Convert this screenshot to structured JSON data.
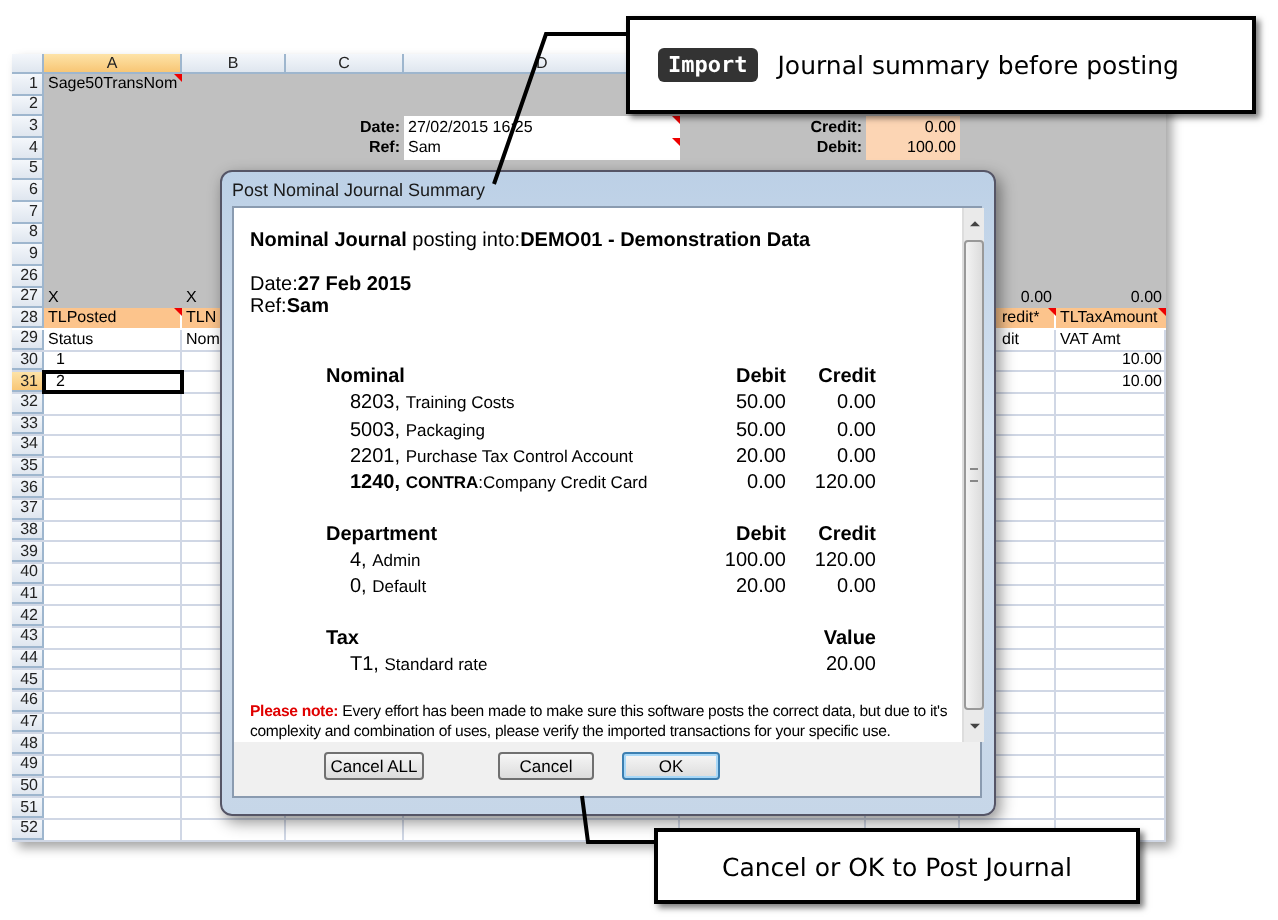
{
  "sheet": {
    "columns": [
      {
        "label": "A",
        "selected": true
      },
      {
        "label": "B",
        "selected": false
      },
      {
        "label": "C",
        "selected": false
      },
      {
        "label": "D",
        "selected": false
      }
    ],
    "rows": [
      {
        "number": "1",
        "selected": false,
        "kind": "form",
        "cells": {
          "A": {
            "text": "Sage50TransNom",
            "kind": "text",
            "comment": true,
            "selected": false
          }
        }
      },
      {
        "number": "2",
        "selected": false,
        "kind": "form"
      },
      {
        "number": "3",
        "selected": false,
        "kind": "form",
        "cells": {
          "C": {
            "text": "Date:",
            "kind": "label",
            "comment": false,
            "selected": false
          },
          "D": {
            "text": "27/02/2015 16:25",
            "kind": "input",
            "comment": true,
            "selected": false
          },
          "E": {
            "text": "Credit:",
            "kind": "label",
            "comment": false,
            "selected": false
          },
          "F": {
            "text": "0.00",
            "kind": "amount",
            "comment": false,
            "selected": false
          }
        }
      },
      {
        "number": "4",
        "selected": false,
        "kind": "form",
        "cells": {
          "C": {
            "text": "Ref:",
            "kind": "label",
            "comment": false,
            "selected": false
          },
          "D": {
            "text": "Sam",
            "kind": "input",
            "comment": true,
            "selected": false
          },
          "E": {
            "text": "Debit:",
            "kind": "label",
            "comment": false,
            "selected": false
          },
          "F": {
            "text": "100.00",
            "kind": "amount",
            "comment": false,
            "selected": false
          }
        }
      },
      {
        "number": "5",
        "selected": false,
        "kind": "form"
      },
      {
        "number": "6",
        "selected": false,
        "kind": "form"
      },
      {
        "number": "7",
        "selected": false,
        "kind": "form"
      },
      {
        "number": "8",
        "selected": false,
        "kind": "form"
      },
      {
        "number": "9",
        "selected": false,
        "kind": "form"
      },
      {
        "number": "26",
        "selected": false,
        "kind": "form"
      },
      {
        "number": "27",
        "selected": false,
        "kind": "form",
        "cells": {
          "A": {
            "text": "X",
            "kind": "text",
            "comment": false,
            "selected": false
          },
          "B": {
            "text": "X",
            "selected": false
          },
          "G": {
            "text": "0.00",
            "kind": "number",
            "comment": false,
            "selected": false
          },
          "H": {
            "text": "0.00",
            "kind": "number",
            "comment": false,
            "selected": false
          }
        }
      },
      {
        "number": "28",
        "selected": false,
        "kind": "header",
        "cells": {
          "A": {
            "text": "TLPosted",
            "kind": "text",
            "comment": true,
            "selected": false
          },
          "B": {
            "text": "TLN",
            "selected": false
          },
          "G": {
            "text": "redit*",
            "kind": "clipped",
            "comment": true,
            "selected": false
          },
          "H": {
            "text": "TLTaxAmount",
            "kind": "text",
            "comment": true,
            "selected": false
          }
        }
      },
      {
        "number": "29",
        "selected": false,
        "kind": "data",
        "cells": {
          "A": {
            "text": "Status",
            "kind": "text",
            "comment": false,
            "selected": false
          },
          "B": {
            "text": "Nom",
            "selected": false
          },
          "G": {
            "text": "dit",
            "kind": "clipped",
            "comment": false,
            "selected": false
          },
          "H": {
            "text": "VAT Amt",
            "kind": "text",
            "comment": false,
            "selected": false
          }
        }
      },
      {
        "number": "30",
        "selected": false,
        "kind": "data",
        "cells": {
          "A": {
            "text": "1",
            "kind": "indent",
            "comment": false,
            "selected": false
          },
          "H": {
            "text": "10.00",
            "kind": "number",
            "comment": false,
            "selected": false
          }
        }
      },
      {
        "number": "31",
        "selected": true,
        "kind": "data",
        "cells": {
          "A": {
            "text": "2",
            "kind": "indent",
            "comment": false,
            "selected": true
          },
          "H": {
            "text": "10.00",
            "kind": "number",
            "comment": false,
            "selected": false
          }
        }
      },
      {
        "number": "32",
        "selected": false,
        "kind": "data"
      },
      {
        "number": "33",
        "selected": false,
        "kind": "data"
      },
      {
        "number": "34",
        "selected": false,
        "kind": "data"
      },
      {
        "number": "35",
        "selected": false,
        "kind": "data"
      },
      {
        "number": "36",
        "selected": false,
        "kind": "data"
      },
      {
        "number": "37",
        "selected": false,
        "kind": "data"
      },
      {
        "number": "38",
        "selected": false,
        "kind": "data"
      },
      {
        "number": "39",
        "selected": false,
        "kind": "data"
      },
      {
        "number": "40",
        "selected": false,
        "kind": "data"
      },
      {
        "number": "41",
        "selected": false,
        "kind": "data"
      },
      {
        "number": "42",
        "selected": false,
        "kind": "data"
      },
      {
        "number": "43",
        "selected": false,
        "kind": "data"
      },
      {
        "number": "44",
        "selected": false,
        "kind": "data"
      },
      {
        "number": "45",
        "selected": false,
        "kind": "data"
      },
      {
        "number": "46",
        "selected": false,
        "kind": "data"
      },
      {
        "number": "47",
        "selected": false,
        "kind": "data"
      },
      {
        "number": "48",
        "selected": false,
        "kind": "data"
      },
      {
        "number": "49",
        "selected": false,
        "kind": "data"
      },
      {
        "number": "50",
        "selected": false,
        "kind": "data"
      },
      {
        "number": "51",
        "selected": false,
        "kind": "data"
      },
      {
        "number": "52",
        "selected": false,
        "kind": "data"
      }
    ]
  },
  "dialog": {
    "title": "Post Nominal Journal Summary",
    "heading": "**Nominal Journal** posting into:**DEMO01 - Demonstration Data**",
    "date": "Date:**27 Feb 2015**",
    "ref": "Ref:**Sam**",
    "sections": [
      {
        "title": "Nominal",
        "columns": [
          "Debit",
          "Credit"
        ],
        "items": [
          {
            "code": "8203,",
            "name": "Training Costs",
            "values": [
              "50.00",
              "0.00"
            ],
            "bold": false
          },
          {
            "code": "5003,",
            "name": "Packaging",
            "values": [
              "50.00",
              "0.00"
            ],
            "bold": false
          },
          {
            "code": "2201,",
            "name": "Purchase Tax Control Account",
            "values": [
              "20.00",
              "0.00"
            ],
            "bold": false
          },
          {
            "code": "1240,",
            "name": "**CONTRA**:Company Credit Card",
            "values": [
              "0.00",
              "120.00"
            ],
            "bold": true
          }
        ]
      },
      {
        "title": "Department",
        "columns": [
          "Debit",
          "Credit"
        ],
        "items": [
          {
            "code": "4,",
            "name": "Admin",
            "values": [
              "100.00",
              "120.00"
            ],
            "bold": false
          },
          {
            "code": "0,",
            "name": "Default",
            "values": [
              "20.00",
              "0.00"
            ],
            "bold": false
          }
        ]
      },
      {
        "title": "Tax",
        "columns": [
          "Value"
        ],
        "items": [
          {
            "code": "T1,",
            "name": "Standard rate",
            "values": [
              "20.00"
            ],
            "bold": false
          }
        ]
      }
    ],
    "note": {
      "lead": "Please note:",
      "text": "Every effort has been made to make sure this software posts the correct data, but due to it's complexity and combination of uses, please verify the imported transactions for your specific use."
    },
    "buttons": [
      {
        "label": "Cancel ALL",
        "default": false
      },
      {
        "label": "Cancel",
        "default": false
      },
      {
        "label": "OK",
        "default": true
      }
    ]
  },
  "callouts": [
    {
      "badge": "Import",
      "text": "Journal summary before posting"
    },
    {
      "text": "Cancel or OK to Post Journal"
    }
  ]
}
